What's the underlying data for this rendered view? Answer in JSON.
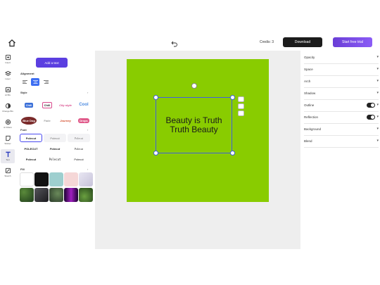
{
  "toolbar": {
    "credits": "Credis: 3",
    "download_label": "Download",
    "trial_label": "Start free trial"
  },
  "rail": {
    "items": [
      {
        "label": "Insert",
        "icon": "insert-icon"
      },
      {
        "label": "Layer",
        "icon": "layers-icon"
      },
      {
        "label": "AI BG",
        "icon": "ai-bg-icon"
      },
      {
        "label": "Change BG",
        "icon": "change-bg-icon"
      },
      {
        "label": "AI Filters",
        "icon": "ai-filters-icon"
      },
      {
        "label": "Sticker",
        "icon": "sticker-icon"
      },
      {
        "label": "Text",
        "icon": "text-icon"
      },
      {
        "label": "Sketch",
        "icon": "sketch-icon"
      }
    ],
    "active_index": 6
  },
  "panel": {
    "add_text_label": "Add a text",
    "alignment_label": "Alignment",
    "style_label": "Style",
    "font_label": "Font",
    "fill_label": "Fill",
    "styles": [
      {
        "text": "Chill",
        "color": "#3a6fd8"
      },
      {
        "text": "Chill",
        "color": "#222222"
      },
      {
        "text": "City style",
        "color": "#d84a8c"
      },
      {
        "text": "Cool",
        "color": "#4a8ae0"
      },
      {
        "text": "Blue Dog",
        "color": "#7a2a2a"
      },
      {
        "text": "Fade",
        "color": "#999999"
      },
      {
        "text": "Journey",
        "color": "#d44a2a"
      },
      {
        "text": "Drops",
        "color": "#e05a8a"
      }
    ],
    "fonts": [
      {
        "text": "Polecut",
        "active": true
      },
      {
        "text": "Polecut",
        "active": false
      },
      {
        "text": "Polecut",
        "active": false
      },
      {
        "text": "POLECUT",
        "active": false
      },
      {
        "text": "Polecut",
        "active": false
      },
      {
        "text": "Polecut",
        "active": false
      },
      {
        "text": "Polecut",
        "active": false
      },
      {
        "text": "Polecut",
        "active": false
      },
      {
        "text": "Polecut",
        "active": false
      }
    ],
    "swatches": [
      "#ffffff",
      "#111111",
      "#9ecfcf",
      "#f5d7d7",
      "#d9d6e8",
      "#2f5a2c",
      "#2b2b2f",
      "#3a4a3a",
      "#6a1aa0",
      "#3a6a2a"
    ]
  },
  "canvas": {
    "background_color": "#89cc00",
    "text_lines": [
      "Beauty is Truth",
      "Truth Beauty"
    ]
  },
  "properties": [
    {
      "label": "Opacity",
      "toggle": false
    },
    {
      "label": "Space",
      "toggle": false
    },
    {
      "label": "Arch",
      "toggle": false
    },
    {
      "label": "Shadow",
      "toggle": false
    },
    {
      "label": "Outline",
      "toggle": true
    },
    {
      "label": "Reflection",
      "toggle": true
    },
    {
      "label": "Background",
      "toggle": false
    },
    {
      "label": "Blend",
      "toggle": false
    }
  ],
  "colors": {
    "accent": "#5b3fe0",
    "selection": "#4060e0"
  }
}
